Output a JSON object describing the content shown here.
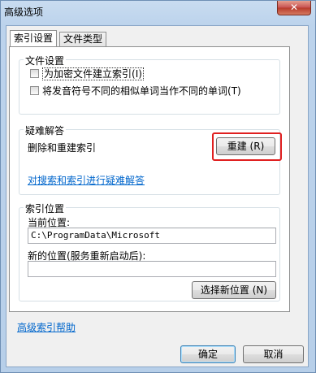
{
  "window": {
    "title": "高级选项",
    "close_glyph": "✕"
  },
  "tabs": [
    {
      "label": "索引设置",
      "selected": true
    },
    {
      "label": "文件类型",
      "selected": false
    }
  ],
  "file_settings": {
    "group_label": "文件设置",
    "encrypt_label": "为加密文件建立索引",
    "encrypt_access_key": "(I)",
    "diacritics_label": "将发音符号不同的相似单词当作不同的单词",
    "diacritics_access_key": "(T)"
  },
  "troubleshooting": {
    "group_label": "疑难解答",
    "rebuild_text": "删除和重建索引",
    "rebuild_button": "重建 (R)",
    "troubleshoot_link": "对搜索和索引进行疑难解答"
  },
  "index_location": {
    "group_label": "索引位置",
    "current_label": "当前位置:",
    "current_value": "C:\\ProgramData\\Microsoft",
    "new_label": "新的位置(服务重新启动后):",
    "new_value": "",
    "select_button": "选择新位置 (N)"
  },
  "help_link": "高级索引帮助",
  "footer": {
    "ok": "确定",
    "cancel": "取消"
  },
  "highlight_color": "#e02020"
}
